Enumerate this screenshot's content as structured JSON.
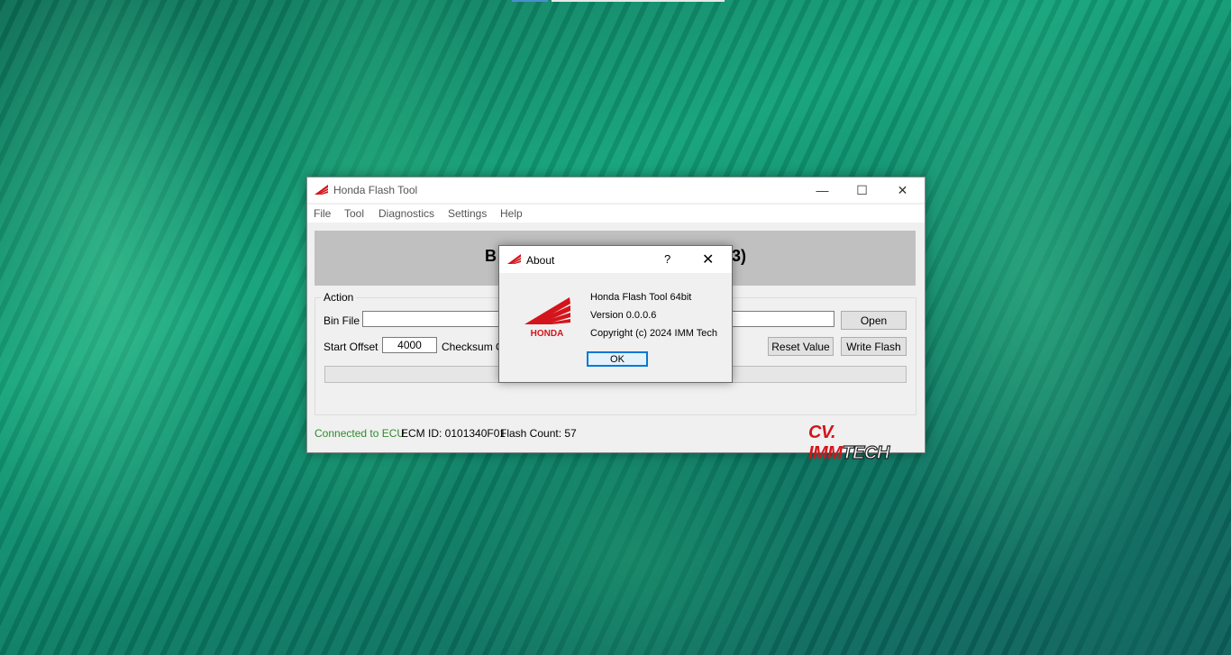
{
  "main_window": {
    "title": "Honda Flash Tool",
    "controls": {
      "minimize": "—",
      "maximize": "☐",
      "close": "✕"
    },
    "menu": [
      "File",
      "Tool",
      "Diagnostics",
      "Settings",
      "Help"
    ],
    "header_left": "B",
    "header_right": "3)",
    "action_group": {
      "label": "Action",
      "bin_file_label": "Bin File",
      "bin_file_value": "",
      "open_button": "Open",
      "start_offset_label": "Start Offset",
      "start_offset_value": "4000",
      "checksum_label": "Checksum Of",
      "reset_button": "Reset Value",
      "write_button": "Write Flash",
      "progress": 0
    },
    "status": {
      "connection": "Connected to ECU",
      "ecm_id": "ECM ID: 0101340F01",
      "flash_count": "Flash Count: 57",
      "connection_color": "#2e8b2e"
    },
    "brand": {
      "part1": "CV. IMM",
      "part2": "TECH"
    }
  },
  "about_dialog": {
    "title": "About",
    "help_glyph": "?",
    "close_glyph": "✕",
    "logo_text": "HONDA",
    "product": "Honda  Flash Tool 64bit",
    "version": "Version 0.0.0.6",
    "copyright": "Copyright (c) 2024 IMM Tech",
    "ok_button": "OK"
  },
  "colors": {
    "honda_red": "#d4141b",
    "accent": "#0078d7"
  }
}
